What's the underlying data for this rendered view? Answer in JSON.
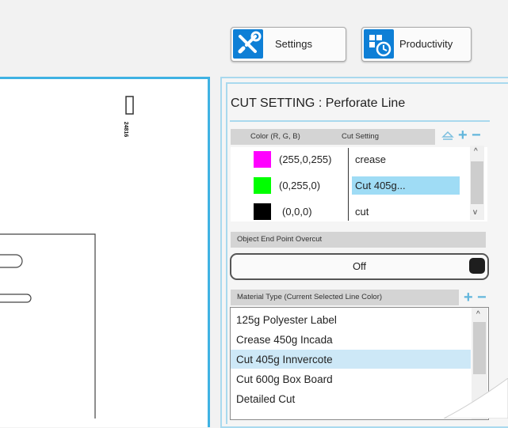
{
  "toolbar": {
    "settings_label": "Settings",
    "productivity_label": "Productivity"
  },
  "canvas": {
    "part_label": "24816"
  },
  "panel": {
    "title": "CUT SETTING : Perforate Line",
    "color_table": {
      "col_color": "Color (R, G, B)",
      "col_cut": "Cut Setting",
      "rows": [
        {
          "rgb": "(255,0,255)",
          "cut": "crease",
          "swatch": "#ff00ff"
        },
        {
          "rgb": "(0,255,0)",
          "cut": "Cut 405g...",
          "swatch": "#00ff00"
        },
        {
          "rgb": "(0,0,0)",
          "cut": "cut",
          "swatch": "#000000"
        }
      ]
    },
    "overcut": {
      "header": "Object End Point Overcut",
      "value": "Off"
    },
    "material": {
      "header": "Material Type (Current Selected Line Color)",
      "items": [
        "125g Polyester Label",
        "Crease 450g Incada",
        "Cut 405g Innvercote",
        "Cut 600g Box Board",
        "Detailed Cut"
      ],
      "selected": "Cut 405g Innvercote"
    }
  },
  "colors": {
    "accent": "#0e7fd6",
    "selection": "#9fdcf5",
    "list_selection": "#cde8f7",
    "border_blue": "#3fb2e3"
  }
}
